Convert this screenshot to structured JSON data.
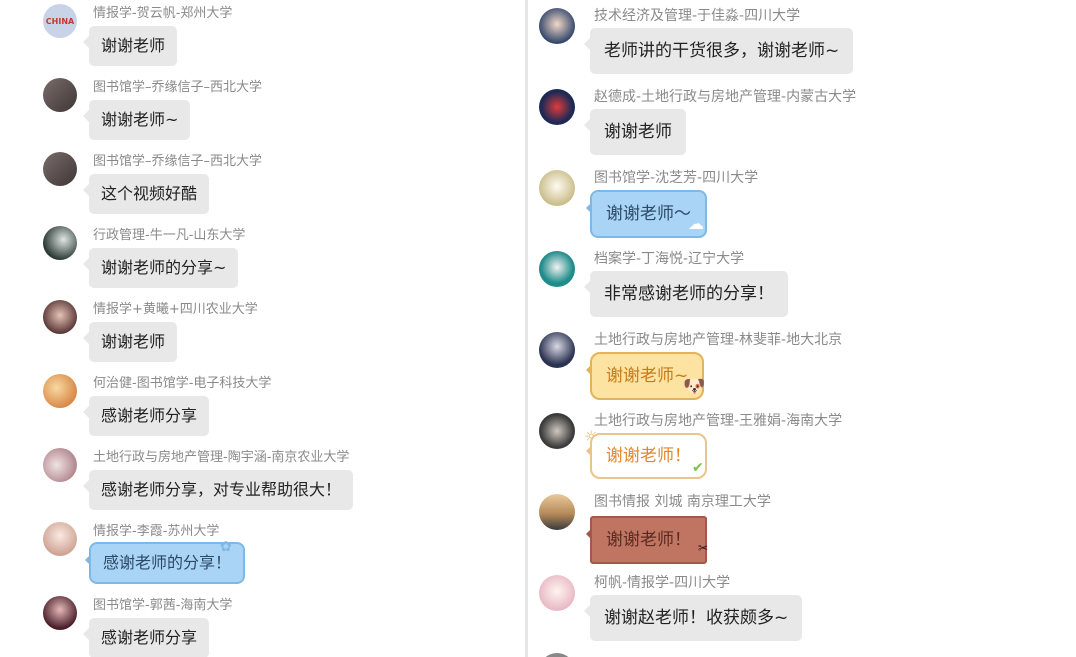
{
  "left_messages": [
    {
      "sender": "情报学-贺云帆-郑州大学",
      "text": "谢谢老师",
      "avatar_color": "#c9d3e8",
      "avatar_text": "CHINA"
    },
    {
      "sender": "图书馆学–乔缘信子–西北大学",
      "text": "谢谢老师~",
      "avatar_color": "#5a5050"
    },
    {
      "sender": "图书馆学–乔缘信子–西北大学",
      "text": "这个视频好酷",
      "avatar_color": "#5a5050"
    },
    {
      "sender": "行政管理-牛一凡-山东大学",
      "text": "谢谢老师的分享~",
      "avatar_color": "#3d4a46"
    },
    {
      "sender": "情报学+黄曦+四川农业大学",
      "text": "谢谢老师",
      "avatar_color": "#8a5a5a"
    },
    {
      "sender": "何治健-图书馆学-电子科技大学",
      "text": "感谢老师分享",
      "avatar_color": "#e6a566"
    },
    {
      "sender": "土地行政与房地产管理-陶宇涵-南京农业大学",
      "text": "感谢老师分享，对专业帮助很大！",
      "avatar_color": "#d7c0c4"
    },
    {
      "sender": "情报学-李霞-苏州大学",
      "text": "感谢老师的分享！",
      "avatar_color": "#e7cfc8"
    },
    {
      "sender": "图书馆学-郭茜-海南大学",
      "text": "感谢老师分享",
      "avatar_color": "#6b3b3b"
    }
  ],
  "right_messages": [
    {
      "sender": "技术经济及管理-于佳淼-四川大学",
      "text": "老师讲的干货很多，谢谢老师~",
      "avatar_color": "#6f86a8"
    },
    {
      "sender": "赵德成-土地行政与房地产管理-内蒙古大学",
      "text": "谢谢老师",
      "avatar_color": "#1e2a55"
    },
    {
      "sender": "图书馆学-沈芝芳-四川大学",
      "text": "谢谢老师～",
      "avatar_color": "#e8e1c8"
    },
    {
      "sender": "档案学-丁海悦-辽宁大学",
      "text": "非常感谢老师的分享！",
      "avatar_color": "#1f8c8a"
    },
    {
      "sender": "土地行政与房地产管理-林斐菲-地大北京",
      "text": "谢谢老师~",
      "avatar_color": "#2c3350"
    },
    {
      "sender": "土地行政与房地产管理-王雅娟-海南大学",
      "text": "谢谢老师！",
      "avatar_color": "#4a4a4a"
    },
    {
      "sender": "图书情报 刘城 南京理工大学",
      "text": "谢谢老师！",
      "avatar_color": "#b59a7e"
    },
    {
      "sender": "柯帆-情报学-四川大学",
      "text": "谢谢赵老师！收获颇多~",
      "avatar_color": "#f1d8dd"
    }
  ],
  "colors": {
    "bubble_default": "#e8e8e8",
    "sender_text": "#8a8a8a",
    "divider": "#e6e6e6"
  }
}
